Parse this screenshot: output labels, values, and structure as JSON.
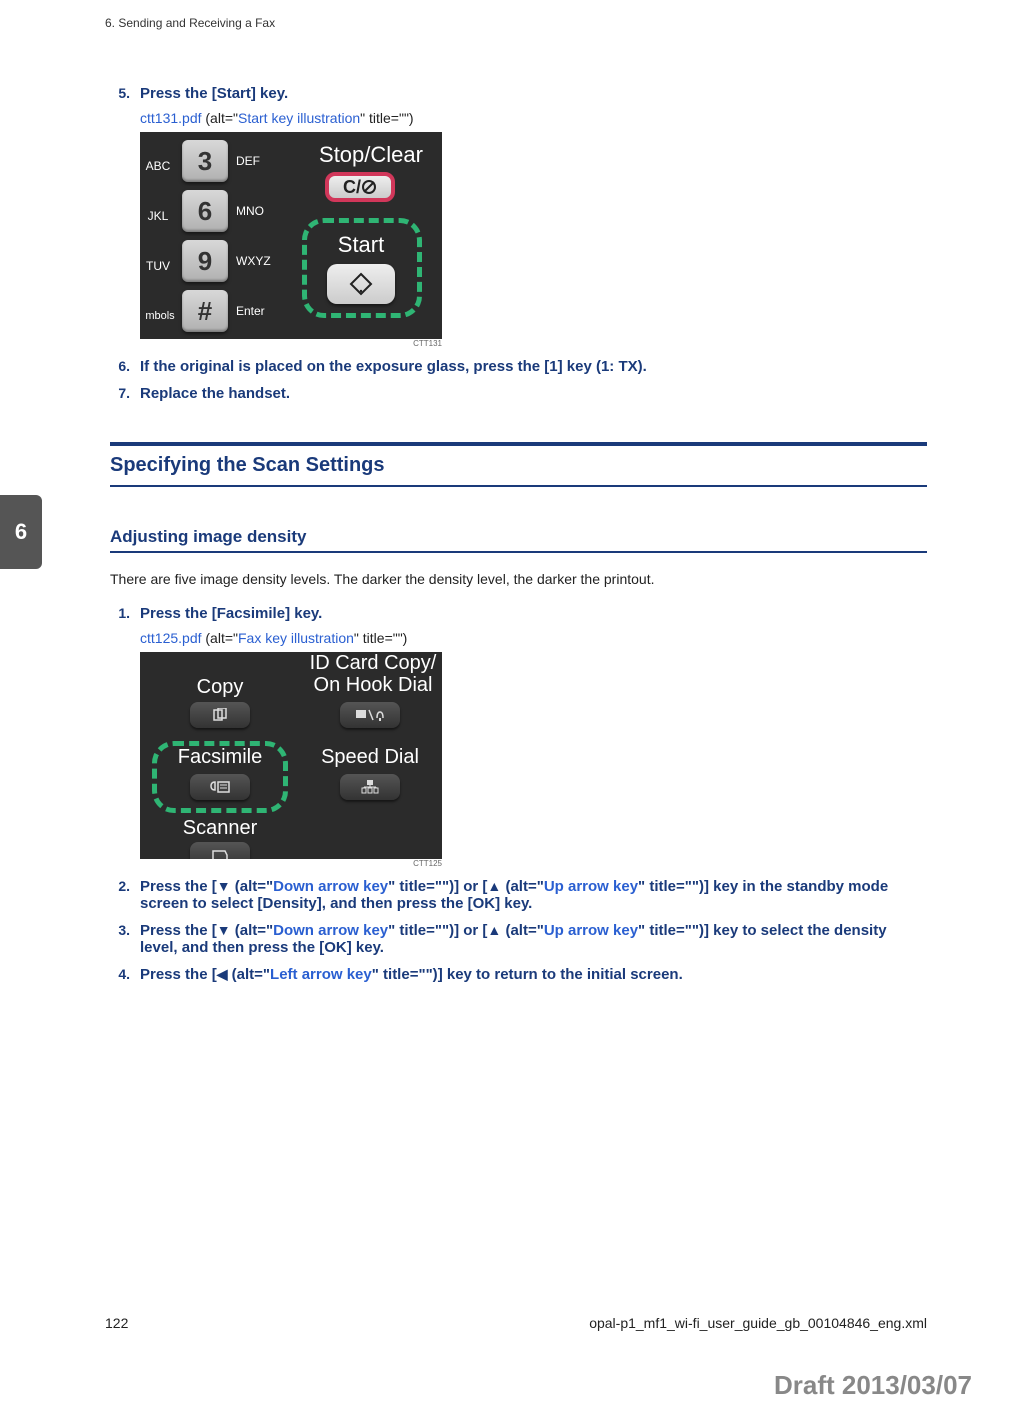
{
  "header": {
    "running": "6. Sending and Receiving a Fax"
  },
  "chapter_tab": "6",
  "steps_a": [
    {
      "num": "5.",
      "text": "Press the [Start] key.",
      "alt_pre": "ctt131.pdf",
      "alt_mid": " (alt=\"",
      "alt_link": "Start key illustration",
      "alt_post": "\" title=\"\")"
    },
    {
      "num": "6.",
      "text": "If the original is placed on the exposure glass, press the [1] key (1: TX)."
    },
    {
      "num": "7.",
      "text": "Replace the handset."
    }
  ],
  "illu1": {
    "left_labels": [
      "ABC",
      "JKL",
      "TUV",
      "mbols"
    ],
    "num_keys": [
      "3",
      "6",
      "9",
      "#"
    ],
    "right_labels": [
      "DEF",
      "MNO",
      "WXYZ",
      "Enter"
    ],
    "stop_label": "Stop/Clear",
    "stop_btn": "C/",
    "start_label": "Start",
    "code": "CTT131"
  },
  "section1": "Specifying the Scan Settings",
  "subsection1": "Adjusting image density",
  "para1": "There are five image density levels. The darker the density level, the darker the printout.",
  "steps_b": {
    "s1": {
      "num": "1.",
      "text": "Press the [Facsimile] key.",
      "alt_pre": "ctt125.pdf",
      "alt_mid": " (alt=\"",
      "alt_link": "Fax key illustration",
      "alt_post": "\" title=\"\")"
    },
    "s2": {
      "num": "2.",
      "pre": "Press the [",
      "down_sym": "▼",
      "down_alt_pre": " (alt=\"",
      "down_alt_link": "Down arrow key",
      "down_alt_post": "\" title=\"\")",
      "mid1": "] or [",
      "up_sym": "▲",
      "up_alt_pre": " (alt=\"",
      "up_alt_link": "Up arrow key",
      "up_alt_post": "\" title=\"\")",
      "post": "] key in the standby mode screen to select [Density], and then press the [OK] key."
    },
    "s3": {
      "num": "3.",
      "pre": "Press the [",
      "down_sym": "▼",
      "down_alt_pre": " (alt=\"",
      "down_alt_link": "Down arrow key",
      "down_alt_post": "\" title=\"\")",
      "mid1": "] or [",
      "up_sym": "▲",
      "up_alt_pre": " (alt=\"",
      "up_alt_link": "Up arrow key",
      "up_alt_post": "\" title=\"\")",
      "post": "] key to select the density level, and then press the [OK] key."
    },
    "s4": {
      "num": "4.",
      "pre": "Press the [",
      "left_sym": "◀",
      "left_alt_pre": " (alt=\"",
      "left_alt_link": "Left arrow key",
      "left_alt_post": "\" title=\"\")",
      "post": "] key to return to the initial screen."
    }
  },
  "illu2": {
    "copy": "Copy",
    "idcard_l1": "ID Card Copy/",
    "idcard_l2": "On Hook Dial",
    "facsimile": "Facsimile",
    "speed": "Speed Dial",
    "scanner": "Scanner",
    "code": "CTT125"
  },
  "footer": {
    "page": "122",
    "file": "opal-p1_mf1_wi-fi_user_guide_gb_00104846_eng.xml"
  },
  "draft": "Draft 2013/03/07"
}
